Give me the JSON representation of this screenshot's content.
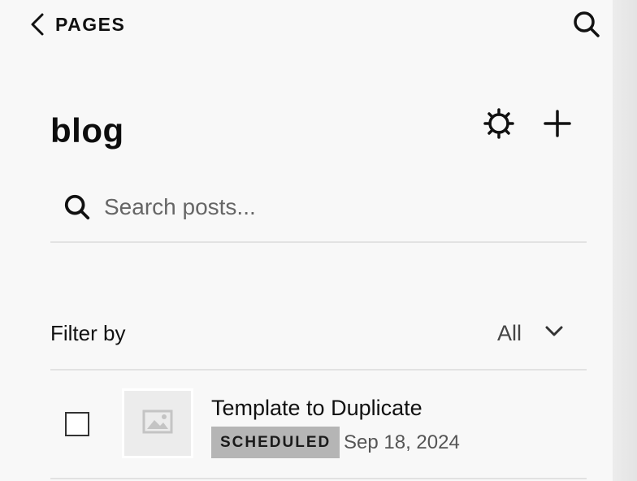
{
  "nav": {
    "back_label": "PAGES",
    "back_icon": "chevron-left-icon",
    "search_icon": "search-icon"
  },
  "header": {
    "title": "blog",
    "settings_icon": "gear-icon",
    "add_icon": "plus-icon"
  },
  "search": {
    "placeholder": "Search posts...",
    "value": ""
  },
  "filter": {
    "label": "Filter by",
    "selected": "All",
    "icon": "chevron-down-icon"
  },
  "posts": [
    {
      "title": "Template to Duplicate",
      "status": "SCHEDULED",
      "date": "Sep 18, 2024",
      "checked": false,
      "thumbnail_icon": "image-placeholder-icon"
    }
  ],
  "colors": {
    "background": "#f8f8f8",
    "status_badge_bg": "#b5b5b5",
    "divider": "#e2e2e2",
    "text_primary": "#111111",
    "text_secondary": "#555555"
  }
}
